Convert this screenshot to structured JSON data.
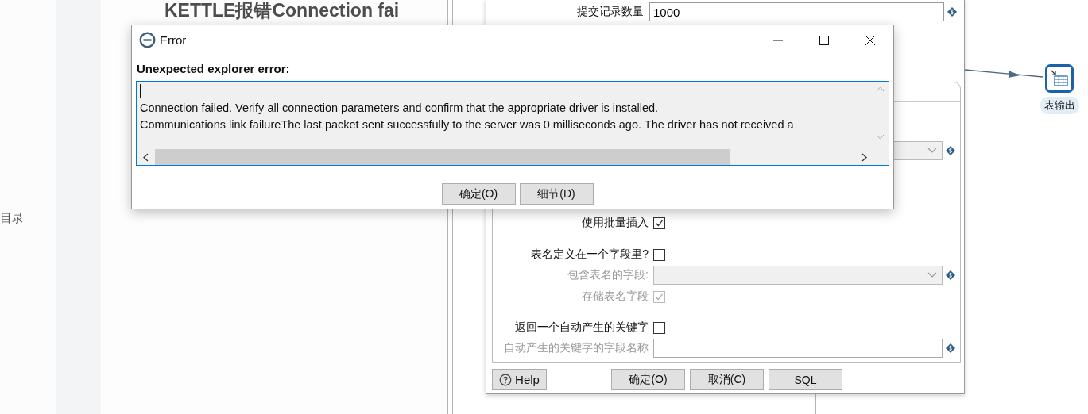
{
  "page": {
    "toc_label": "目录",
    "article_title": "KETTLE报错Connection fai"
  },
  "canvas": {
    "step_label": "表输出"
  },
  "output_dialog": {
    "top_field": {
      "label": "提交记录数量",
      "value": "1000"
    },
    "rows": [
      {
        "kind": "combo",
        "disabled": true
      },
      {
        "kind": "checkbox",
        "label": "使用批量插入",
        "checked": true,
        "disabled": false
      },
      {
        "kind": "checkbox",
        "label": "表名定义在一个字段里?",
        "checked": false,
        "disabled": false
      },
      {
        "kind": "combo",
        "label": "包含表名的字段:",
        "disabled": true
      },
      {
        "kind": "checkbox",
        "label": "存储表名字段",
        "checked": true,
        "disabled": true
      },
      {
        "kind": "checkbox",
        "label": "返回一个自动产生的关键字",
        "checked": false,
        "disabled": false
      },
      {
        "kind": "text",
        "label": "自动产生的关键字的字段名称",
        "disabled": true
      }
    ],
    "help_button": "Help",
    "buttons": [
      "确定(O)",
      "取消(C)",
      "SQL"
    ]
  },
  "error_dialog": {
    "title": "Error",
    "heading": "Unexpected explorer error:",
    "lines": [
      "Connection failed. Verify all connection parameters and confirm that the appropriate driver is installed.",
      "Communications link failureThe last packet sent successfully to the server was 0 milliseconds ago. The driver has not received a"
    ],
    "buttons": [
      "确定(O)",
      "细节(D)"
    ]
  }
}
